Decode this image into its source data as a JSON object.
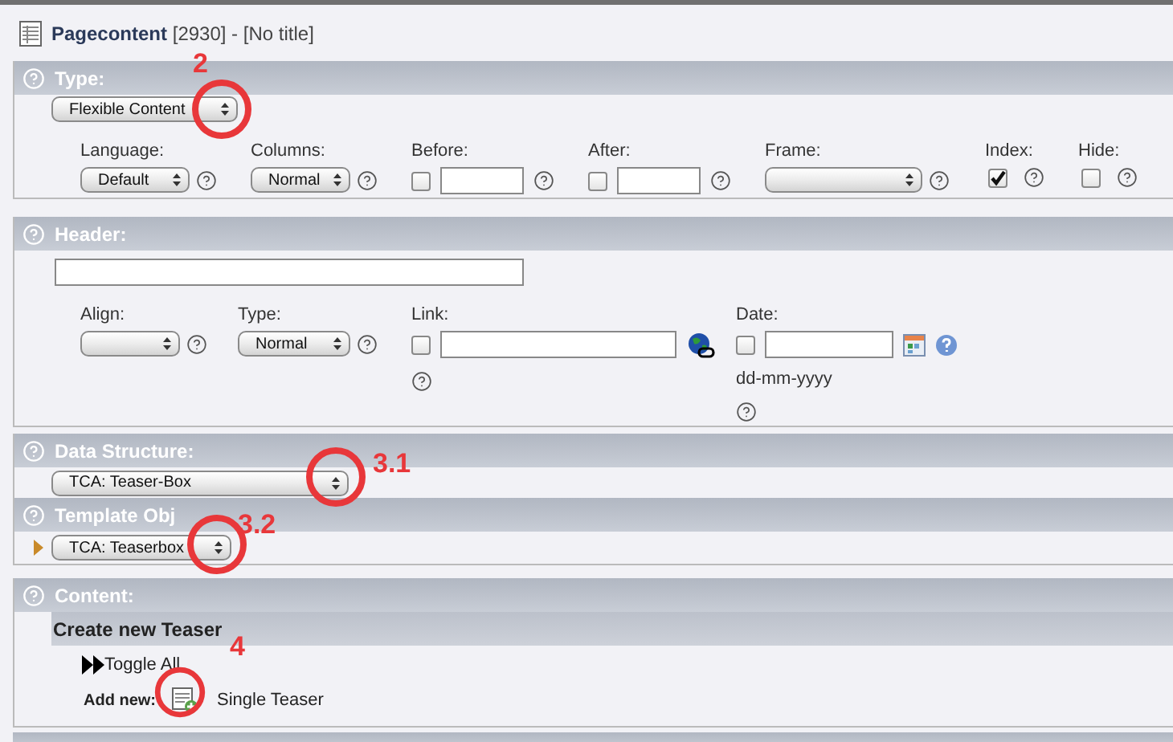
{
  "page_title": {
    "name": "Pagecontent",
    "rest": "[2930] - [No title]"
  },
  "type_section": {
    "label": "Type:",
    "value": "Flexible Content",
    "fields": [
      {
        "kind": "select",
        "label": "Language:",
        "value": "Default"
      },
      {
        "kind": "select",
        "label": "Columns:",
        "value": "Normal"
      },
      {
        "kind": "checkbox_input",
        "label": "Before:",
        "checked": false
      },
      {
        "kind": "checkbox_input",
        "label": "After:",
        "checked": false
      },
      {
        "kind": "select",
        "label": "Frame:"
      },
      {
        "kind": "checkbox",
        "label": "Index:",
        "checked": true
      },
      {
        "kind": "checkbox",
        "label": "Hide:",
        "checked": false
      }
    ]
  },
  "header_section": {
    "label": "Header:",
    "fields": [
      {
        "kind": "select",
        "label": "Align:"
      },
      {
        "kind": "select",
        "label": "Type:",
        "value": "Normal"
      },
      {
        "kind": "link",
        "label": "Link:",
        "checked": false
      },
      {
        "kind": "date",
        "label": "Date:",
        "checked": false,
        "hint": "dd-mm-yyyy"
      }
    ]
  },
  "data_structure": {
    "label": "Data Structure:",
    "value": "TCA: Teaser-Box"
  },
  "template_object": {
    "label": "Template Obj",
    "value": "TCA: Teaserbox"
  },
  "content": {
    "label": "Content:",
    "subheader": "Create new Teaser",
    "toggle": "Toggle All",
    "add_new_label": "Add new:",
    "add_new_item": "Single Teaser"
  },
  "annotations": [
    {
      "label": "2"
    },
    {
      "label": "3.1"
    },
    {
      "label": "3.2"
    },
    {
      "label": "4"
    }
  ]
}
